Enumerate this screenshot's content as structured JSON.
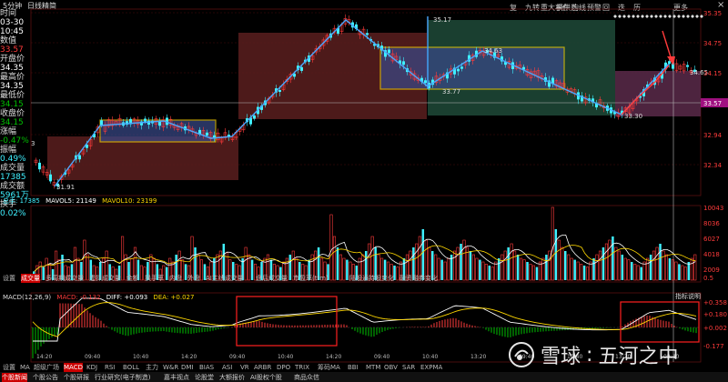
{
  "colors": {
    "up": "#ff3b3b",
    "down": "#3ff0ff",
    "yellow": "#ffd800",
    "white": "#ffffff",
    "magenta": "#ff4bff",
    "green": "#00c000",
    "grid": "#5a1010",
    "box_red": "#5a1f1f",
    "box_blue": "#3a4a8a",
    "box_green": "#1f4a38",
    "box_pink": "#5a2a4a"
  },
  "header": {
    "period": "5分钟",
    "kind": "日线精简"
  },
  "toolbar": {
    "items": [
      "复",
      "九转",
      "重大事件",
      "捐供选",
      "均线",
      "预警",
      "回",
      "迭",
      "历",
      "画线",
      "设置",
      "操作",
      "显示"
    ],
    "more": "更多",
    "close": "×"
  },
  "info_panel": {
    "time_label": "时间",
    "date": "03-30",
    "clock": "10:45",
    "value_label": "数值",
    "value": "33.57",
    "open_label": "开盘价",
    "open": "34.35",
    "high_label": "最高价",
    "high": "34.35",
    "low_label": "最低价",
    "low": "34.15",
    "close_label": "收盘价",
    "close": "34.15",
    "change_label": "涨幅",
    "change": "-0.47%",
    "amp_label": "振幅",
    "amp": "0.49%",
    "vol_label": "成交量",
    "vol": "17385",
    "amt_label": "成交额",
    "amt": "5961万",
    "turn_label": "换手",
    "turn": "0.02%"
  },
  "price_axis": [
    "35.35",
    "34.75",
    "34.15",
    "33.57",
    "32.94",
    "32.34"
  ],
  "price_annotations": {
    "high1": "35.17",
    "high2": "34.63",
    "low1": "31.91",
    "low2": "33.77",
    "low3": "33.30",
    "cur": "34.65",
    "p3": "3"
  },
  "volume": {
    "label": "总手: 17385",
    "ma5_label": "MAVOL5: 21149",
    "ma10_label": "MAVOL10: 23199",
    "axis": [
      "10043",
      "8036",
      "6027",
      "4018",
      "2009",
      "0.5",
      "百"
    ],
    "values": [
      12,
      20,
      25,
      18,
      30,
      22,
      15,
      40,
      28,
      35,
      20,
      18,
      22,
      45,
      30,
      25,
      55,
      35,
      28,
      20,
      18,
      25,
      30,
      40,
      22,
      18,
      15,
      20,
      60,
      35,
      25,
      30,
      45,
      28,
      20,
      18,
      25,
      35,
      30,
      22,
      15,
      20,
      18,
      30,
      25,
      35,
      40,
      28,
      22,
      20,
      60,
      45,
      35,
      28,
      22,
      18,
      25,
      30,
      35,
      40,
      50,
      38,
      28,
      25,
      22,
      20,
      30,
      45,
      35,
      28,
      22,
      18,
      25,
      30,
      35,
      28,
      22,
      20,
      18,
      25,
      30,
      35,
      40,
      30,
      25,
      22,
      20,
      28,
      35,
      40,
      45,
      30,
      25,
      22,
      90,
      60,
      45,
      35,
      30,
      28,
      25,
      22,
      20,
      30,
      35,
      40,
      50,
      60,
      45,
      35,
      30,
      28,
      25,
      22,
      20,
      18,
      25,
      30,
      35,
      40,
      45,
      50,
      60,
      70,
      55,
      45,
      40,
      35,
      30,
      28,
      25,
      30,
      35,
      40,
      45,
      50,
      55,
      45,
      40,
      35,
      30,
      28,
      25,
      22,
      20,
      18,
      25,
      30,
      35,
      40,
      45,
      50,
      40,
      35,
      30,
      28,
      25,
      22,
      20,
      18,
      25,
      30,
      35,
      40,
      100,
      70,
      55,
      45,
      40,
      35,
      30,
      28,
      25,
      22,
      20,
      18,
      25,
      30,
      35,
      40,
      45,
      50,
      55,
      60,
      45,
      40,
      35,
      30,
      28,
      25,
      22,
      20,
      18,
      25,
      30,
      35,
      40,
      45,
      50,
      40,
      35,
      30,
      28,
      25,
      22,
      20,
      18,
      25,
      30,
      35
    ]
  },
  "indicator_tabs": [
    "设置",
    "成交量",
    "多周期成交量",
    "虚拟成交量",
    "金额",
    "换手率",
    "内盘",
    "外盘",
    "AI主线成交量",
    "盘后成交量",
    "市盈率(ttm)",
    "陆股通持股变化",
    "融资融券变化"
  ],
  "macd": {
    "label": "MACD(12,26,9)",
    "macd_val": "MACD: -0.132",
    "dif_val": "DIFF: +0.093",
    "dea_val": "DEA: +0.027",
    "axis": [
      "+0.358",
      "+0.180",
      "+0.002",
      "-0.177"
    ],
    "legend_btn": "指标说明"
  },
  "time_axis": [
    "14:20",
    "09:40",
    "10:40",
    "14:20",
    "09:40",
    "10:40",
    "14:20",
    "09:40",
    "10:40",
    "13:20",
    "09:40",
    "10:40",
    "13:20",
    "09:40"
  ],
  "indicator_buttons": [
    "设置",
    "MA",
    "超级广场",
    "MACD",
    "KDJ",
    "RSI",
    "BOLL",
    "主力",
    "W&R",
    "DMI",
    "BIAS",
    "ASI",
    "VR",
    "ARBR",
    "DPO",
    "TRIX",
    "筹码MA",
    "BBI",
    "MTM",
    "OBV",
    "SAR",
    "EXPMA"
  ],
  "bottom_tabs": [
    "个股新闻",
    "个股公告",
    "个股研报",
    "行业研究(电子制造)",
    "嘉丰视点",
    "论股堂",
    "大额报价",
    "AI股权个股",
    "商品众信"
  ],
  "watermark": {
    "brand": "雪球",
    "sep": ":",
    "user": "五河之中"
  }
}
